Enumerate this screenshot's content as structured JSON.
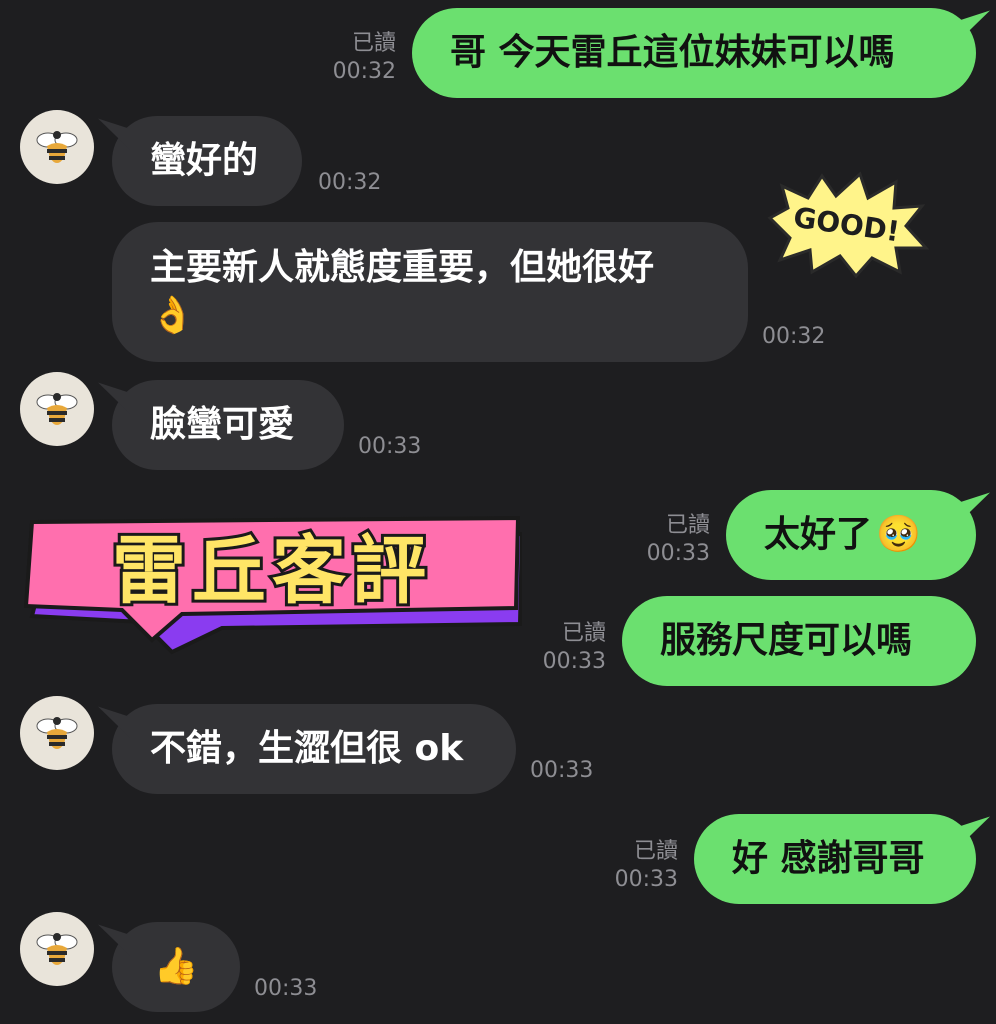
{
  "messages": [
    {
      "id": "m1",
      "side": "out",
      "text": "哥 今天雷丘這位妹妹可以嗎",
      "read": "已讀",
      "time": "00:32"
    },
    {
      "id": "m2",
      "side": "in",
      "text": "蠻好的",
      "time": "00:32"
    },
    {
      "id": "m3",
      "side": "in",
      "text": "主要新人就態度重要，但她很好",
      "emoji": "👌",
      "time": "00:32"
    },
    {
      "id": "m4",
      "side": "in",
      "text": "臉蠻可愛",
      "time": "00:33"
    },
    {
      "id": "m5",
      "side": "out",
      "text": "太好了",
      "emoji": "🥹",
      "read": "已讀",
      "time": "00:33"
    },
    {
      "id": "m6",
      "side": "out",
      "text": "服務尺度可以嗎",
      "read": "已讀",
      "time": "00:33"
    },
    {
      "id": "m7",
      "side": "in",
      "text": "不錯，生澀但很 ok",
      "time": "00:33"
    },
    {
      "id": "m8",
      "side": "out",
      "text": "好 感謝哥哥",
      "read": "已讀",
      "time": "00:33"
    },
    {
      "id": "m9",
      "side": "in",
      "emoji": "👍",
      "time": "00:33"
    }
  ],
  "overlays": {
    "banner_text": "雷丘客評",
    "sticker_text": "GOOD!"
  },
  "icons": {
    "avatar": "bee-icon"
  },
  "colors": {
    "background": "#1e1e20",
    "outgoing_bubble": "#6be06f",
    "incoming_bubble": "#333336",
    "meta_text": "#8e8e93",
    "banner_pink": "#ff6fae",
    "banner_purple": "#8a3cf0",
    "banner_text": "#ffe566",
    "sticker_yellow": "#fff48a"
  }
}
